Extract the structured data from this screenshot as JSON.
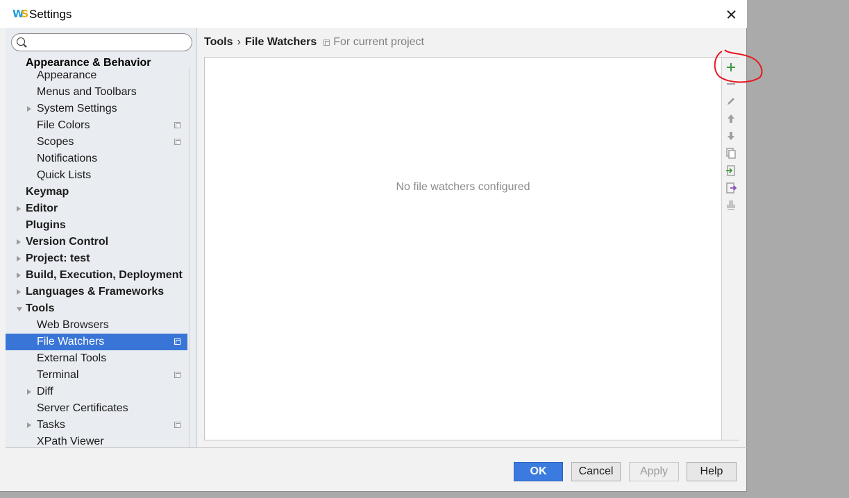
{
  "window": {
    "title": "Settings"
  },
  "search": {
    "placeholder": "",
    "value": ""
  },
  "tree": {
    "header_label": "Appearance & Behavior",
    "items": [
      {
        "label": "Appearance",
        "level": 1,
        "bold": false,
        "arrow": "none",
        "project_icon": false,
        "selected": false
      },
      {
        "label": "Menus and Toolbars",
        "level": 1,
        "bold": false,
        "arrow": "none",
        "project_icon": false,
        "selected": false
      },
      {
        "label": "System Settings",
        "level": 1,
        "bold": false,
        "arrow": "right",
        "project_icon": false,
        "selected": false
      },
      {
        "label": "File Colors",
        "level": 1,
        "bold": false,
        "arrow": "none",
        "project_icon": true,
        "selected": false
      },
      {
        "label": "Scopes",
        "level": 1,
        "bold": false,
        "arrow": "none",
        "project_icon": true,
        "selected": false
      },
      {
        "label": "Notifications",
        "level": 1,
        "bold": false,
        "arrow": "none",
        "project_icon": false,
        "selected": false
      },
      {
        "label": "Quick Lists",
        "level": 1,
        "bold": false,
        "arrow": "none",
        "project_icon": false,
        "selected": false
      },
      {
        "label": "Keymap",
        "level": 0,
        "bold": true,
        "arrow": "none",
        "project_icon": false,
        "selected": false
      },
      {
        "label": "Editor",
        "level": 0,
        "bold": true,
        "arrow": "right",
        "project_icon": false,
        "selected": false
      },
      {
        "label": "Plugins",
        "level": 0,
        "bold": true,
        "arrow": "none",
        "project_icon": false,
        "selected": false
      },
      {
        "label": "Version Control",
        "level": 0,
        "bold": true,
        "arrow": "right",
        "project_icon": false,
        "selected": false
      },
      {
        "label": "Project: test",
        "level": 0,
        "bold": true,
        "arrow": "right",
        "project_icon": false,
        "selected": false
      },
      {
        "label": "Build, Execution, Deployment",
        "level": 0,
        "bold": true,
        "arrow": "right",
        "project_icon": false,
        "selected": false
      },
      {
        "label": "Languages & Frameworks",
        "level": 0,
        "bold": true,
        "arrow": "right",
        "project_icon": false,
        "selected": false
      },
      {
        "label": "Tools",
        "level": 0,
        "bold": true,
        "arrow": "down",
        "project_icon": false,
        "selected": false
      },
      {
        "label": "Web Browsers",
        "level": 1,
        "bold": false,
        "arrow": "none",
        "project_icon": false,
        "selected": false
      },
      {
        "label": "File Watchers",
        "level": 1,
        "bold": false,
        "arrow": "none",
        "project_icon": true,
        "selected": true
      },
      {
        "label": "External Tools",
        "level": 1,
        "bold": false,
        "arrow": "none",
        "project_icon": false,
        "selected": false
      },
      {
        "label": "Terminal",
        "level": 1,
        "bold": false,
        "arrow": "none",
        "project_icon": true,
        "selected": false
      },
      {
        "label": "Diff",
        "level": 1,
        "bold": false,
        "arrow": "right",
        "project_icon": false,
        "selected": false
      },
      {
        "label": "Server Certificates",
        "level": 1,
        "bold": false,
        "arrow": "none",
        "project_icon": false,
        "selected": false
      },
      {
        "label": "Tasks",
        "level": 1,
        "bold": false,
        "arrow": "right",
        "project_icon": true,
        "selected": false
      },
      {
        "label": "XPath Viewer",
        "level": 1,
        "bold": false,
        "arrow": "none",
        "project_icon": false,
        "selected": false
      }
    ]
  },
  "breadcrumb": {
    "parent": "Tools",
    "separator": "›",
    "current": "File Watchers",
    "note": "For current project"
  },
  "content": {
    "empty_text": "No file watchers configured"
  },
  "toolbar": {
    "icons": [
      "add-icon",
      "remove-icon",
      "edit-icon",
      "move-up-icon",
      "move-down-icon",
      "copy-icon",
      "import-icon",
      "export-icon",
      "stamp-icon"
    ],
    "add_color": "#3c9a3c",
    "annotation_color": "#e8171f"
  },
  "footer": {
    "ok": "OK",
    "cancel": "Cancel",
    "apply": "Apply",
    "help": "Help"
  },
  "colors": {
    "selection": "#3875d7",
    "ok_button": "#3b7be0",
    "sidebar_bg": "#e9ecf0"
  }
}
